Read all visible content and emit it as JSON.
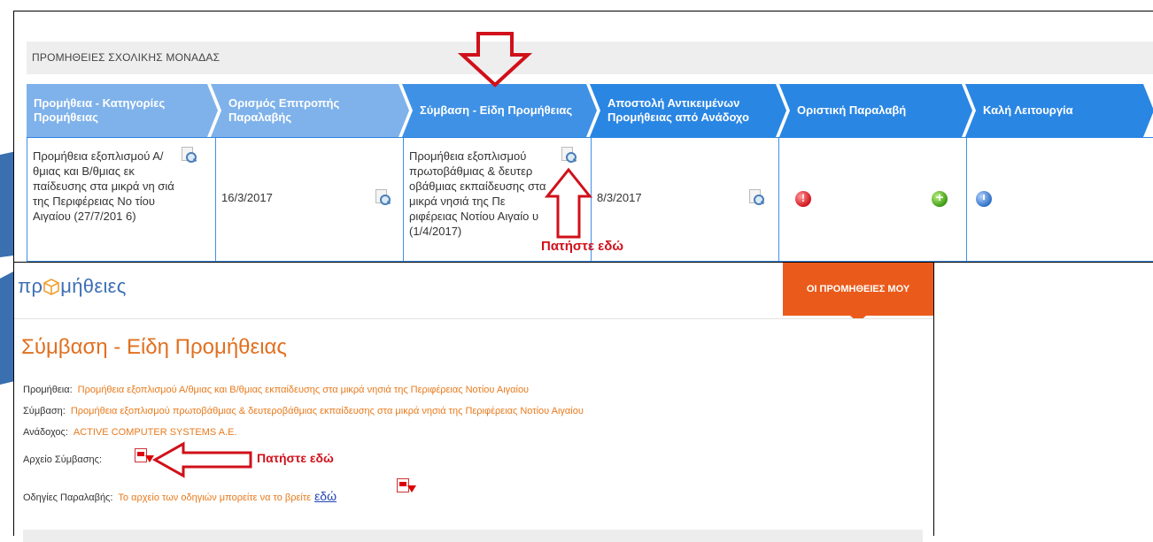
{
  "section": {
    "title": "ΠΡΟΜΗΘΕΙΕΣ ΣΧΟΛΙΚΗΣ ΜΟΝΑΔΑΣ"
  },
  "steps": [
    {
      "label": "Προμήθεια - Κατηγορίες Προμήθειας"
    },
    {
      "label": "Ορισμός Επιτροπής Παραλαβής"
    },
    {
      "label": "Σύμβαση - Είδη Προμήθειας"
    },
    {
      "label": "Αποστολή Αντικειμένων Προμήθειας από Ανάδοχο"
    },
    {
      "label": "Οριστική Παραλαβή"
    },
    {
      "label": "Καλή Λειτουργία"
    }
  ],
  "cells": {
    "procurement": "Προμήθεια εξοπλισμού Α/θμιας και Β/θμιας εκ παίδευσης στα μικρά νη σιά της Περιφέρειας Νο τίου Αιγαίου (27/7/201 6)",
    "committee_date": "16/3/2017",
    "contract": "Προμήθεια εξοπλισμού πρωτοβάθμιας & δευτερ οβάθμιας εκπαίδευσης στα μικρά νησιά της Πε ριφέρειας Νοτίου Αιγαίο υ (1/4/2017)",
    "shipment_date": "8/3/2017"
  },
  "annotations": {
    "click_here": "Πατήστε εδώ"
  },
  "app": {
    "logo_text_left": "πρ",
    "logo_text_right": "μήθειες",
    "nav_tab": "ΟΙ ΠΡΟΜΗΘΕΙΕΣ ΜΟΥ",
    "page_title": "Σύμβαση - Είδη Προμήθειας",
    "fields": {
      "procurement_label": "Προμήθεια:",
      "procurement_value": "Προμήθεια εξοπλισμού Α/θμιας και Β/θμιας εκπαίδευσης στα μικρά νησιά της Περιφέρειας Νοτίου Αιγαίου",
      "contract_label": "Σύμβαση:",
      "contract_value": "Προμήθεια εξοπλισμού πρωτοβάθμιας & δευτεροβάθμιας εκπαίδευσης στα μικρά νησιά της Περιφέρειας Νοτίου Αιγαίου",
      "contractor_label": "Ανάδοχος:",
      "contractor_value": "ACTIVE COMPUTER SYSTEMS A.E.",
      "contract_file_label": "Αρχείο Σύμβασης:",
      "instructions_label": "Οδηγίες Παραλαβής:",
      "instructions_value": "Το αρχείο των οδηγιών μπορείτε να το βρείτε",
      "instructions_link": "εδώ"
    }
  },
  "colors": {
    "accent": "#ea5b1b",
    "step_done": "#7fb2ea",
    "step_current": "#3f91e6",
    "step_todo": "#2a86e3",
    "annotation": "#d0101a"
  },
  "icons": [
    "zoom-icon",
    "error-icon",
    "add-icon",
    "clock-icon",
    "pdf-download-icon",
    "down-arrow-icon",
    "up-arrow-icon",
    "left-arrow-icon"
  ]
}
